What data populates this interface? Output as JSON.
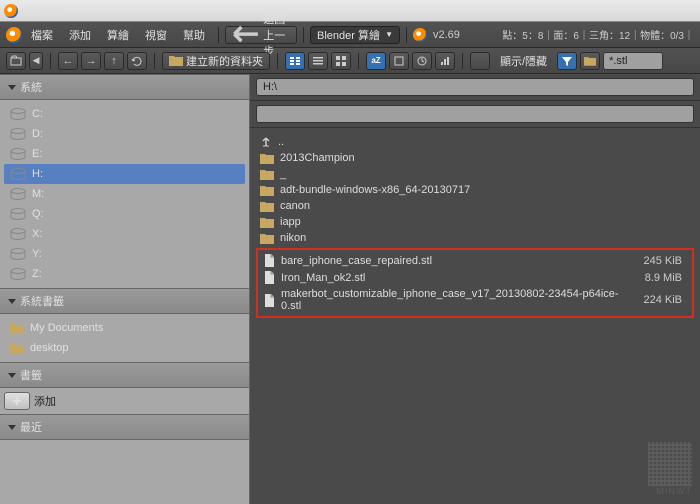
{
  "title": "Blender",
  "menu": {
    "file": "檔案",
    "add": "添加",
    "calc": "算繪",
    "window": "視窗",
    "help": "幫助"
  },
  "back_btn": "返回上一步",
  "scene_sel": "Blender 算繪",
  "version": "v2.69",
  "stats": "點：5：8｜面：6｜三角：12｜物體：0/3｜",
  "tb": {
    "newfolder": "建立新的資料夾",
    "showhide": "顯示/隱藏",
    "filter": "*.stl"
  },
  "sidebar": {
    "system": "系統",
    "drives": [
      "C:",
      "D:",
      "E:",
      "H:",
      "M:",
      "Q:",
      "X:",
      "Y:",
      "Z:"
    ],
    "selected": "H:",
    "sysbm": "系統書籤",
    "bookmarks": [
      "My Documents",
      "desktop"
    ],
    "bm": "書籤",
    "add": "添加",
    "recent": "最近"
  },
  "path": "H:\\",
  "files": {
    "up": "..",
    "folders": [
      "2013Champion",
      "_",
      "adt-bundle-windows-x86_64-20130717",
      "canon",
      "iapp",
      "nikon"
    ],
    "stl": [
      {
        "name": "bare_iphone_case_repaired.stl",
        "size": "245 KiB"
      },
      {
        "name": "Iron_Man_ok2.stl",
        "size": "8.9 MiB"
      },
      {
        "name": "makerbot_customizable_iphone_case_v17_20130802-23454-p64ice-0.stl",
        "size": "224 KiB"
      }
    ]
  },
  "wm": "MINWT"
}
